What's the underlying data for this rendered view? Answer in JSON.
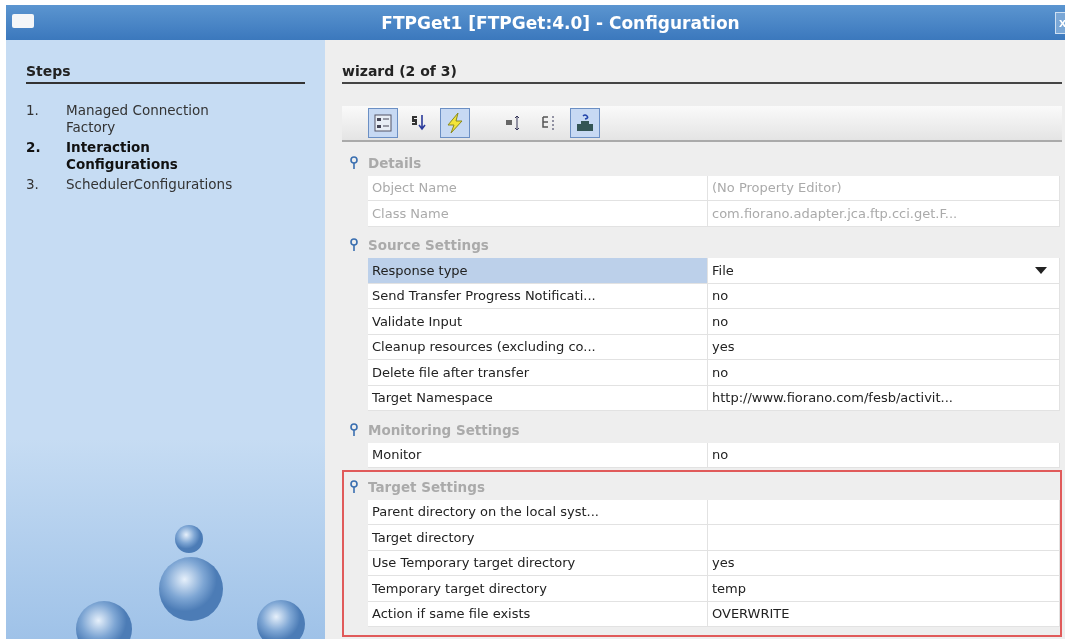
{
  "window": {
    "title": "FTPGet1 [FTPGet:4.0] - Configuration",
    "close": "x"
  },
  "steps": {
    "title": "Steps",
    "items": [
      {
        "number": "1.",
        "label": "Managed Connection Factory",
        "selected": false
      },
      {
        "number": "2.",
        "label": "Interaction Configurations",
        "selected": true
      },
      {
        "number": "3.",
        "label": "SchedulerConfigurations",
        "selected": false
      }
    ]
  },
  "wizard": {
    "title": "wizard (2 of 3)"
  },
  "toolbar": [
    {
      "kind": "categorized",
      "selected": true
    },
    {
      "kind": "sort",
      "selected": false
    },
    {
      "kind": "lightning",
      "selected": true
    },
    {
      "kind": "expand",
      "selected": false
    },
    {
      "kind": "collapse",
      "selected": false
    },
    {
      "kind": "help",
      "selected": true
    }
  ],
  "sections": [
    {
      "title": "Details",
      "highlighted": false,
      "rows": [
        {
          "name": "Object Name",
          "value": "(No Property Editor)",
          "disabled": true,
          "selected": false,
          "dropdown": false
        },
        {
          "name": "Class Name",
          "value": "com.fiorano.adapter.jca.ftp.cci.get.F...",
          "disabled": true,
          "selected": false,
          "dropdown": false
        }
      ]
    },
    {
      "title": "Source Settings",
      "highlighted": false,
      "rows": [
        {
          "name": "Response type",
          "value": "File",
          "disabled": false,
          "selected": true,
          "dropdown": true
        },
        {
          "name": "Send Transfer Progress Notificati...",
          "value": "no",
          "disabled": false,
          "selected": false,
          "dropdown": false
        },
        {
          "name": "Validate Input",
          "value": "no",
          "disabled": false,
          "selected": false,
          "dropdown": false
        },
        {
          "name": "Cleanup resources (excluding co...",
          "value": "yes",
          "disabled": false,
          "selected": false,
          "dropdown": false
        },
        {
          "name": "Delete file after transfer",
          "value": "no",
          "disabled": false,
          "selected": false,
          "dropdown": false
        },
        {
          "name": "Target Namespace",
          "value": "http://www.fiorano.com/fesb/activit...",
          "disabled": false,
          "selected": false,
          "dropdown": false
        }
      ]
    },
    {
      "title": "Monitoring Settings",
      "highlighted": false,
      "rows": [
        {
          "name": "Monitor",
          "value": "no",
          "disabled": false,
          "selected": false,
          "dropdown": false
        }
      ]
    },
    {
      "title": "Target Settings",
      "highlighted": true,
      "rows": [
        {
          "name": "Parent directory on the local syst...",
          "value": "",
          "disabled": false,
          "selected": false,
          "dropdown": false
        },
        {
          "name": "Target directory",
          "value": "",
          "disabled": false,
          "selected": false,
          "dropdown": false
        },
        {
          "name": "Use Temporary target directory",
          "value": "yes",
          "disabled": false,
          "selected": false,
          "dropdown": false
        },
        {
          "name": "Temporary target directory",
          "value": "temp",
          "disabled": false,
          "selected": false,
          "dropdown": false
        },
        {
          "name": "Action if same file exists",
          "value": "OVERWRITE",
          "disabled": false,
          "selected": false,
          "dropdown": false
        }
      ]
    }
  ]
}
